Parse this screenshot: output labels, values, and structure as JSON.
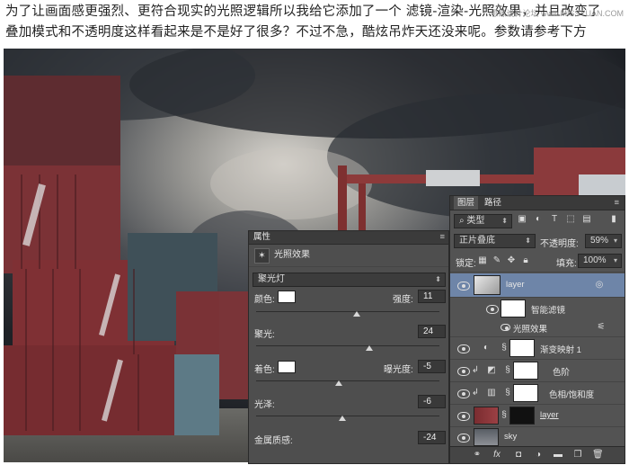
{
  "intro": {
    "line1": "为了让画面感更强烈、更符合现实的光照逻辑所以我给它添加了一个 滤镜-渲染-光照效果，并且改变了",
    "line2": "叠加模式和不透明度这样看起来是不是好了很多？不过不急，酷炫吊炸天还没来呢。参数请参考下方",
    "watermark": "思缘设计论坛 www.MISSYUAN.COM"
  },
  "properties": {
    "header": "属性",
    "title": "光照效果",
    "preset": "聚光灯",
    "color_label": "颜色:",
    "intensity_label": "强度:",
    "intensity": "11",
    "hotspot_label": "聚光:",
    "hotspot": "24",
    "colorize_label": "着色:",
    "exposure_label": "曝光度:",
    "exposure": "-5",
    "gloss_label": "光泽:",
    "gloss": "-6",
    "metallic_label": "金属质感:",
    "metallic": "-24",
    "sliders": {
      "intensity": 0.55,
      "hotspot": 0.62,
      "exposure": 0.45,
      "gloss": 0.47
    }
  },
  "layers": {
    "tabs": [
      "图层",
      "路径"
    ],
    "filter_kind": "类型",
    "blend_mode": "正片叠底",
    "opacity_label": "不透明度:",
    "opacity": "59%",
    "lock_label": "锁定:",
    "fill_label": "填充:",
    "fill": "100%",
    "items": [
      {
        "name": "layer",
        "type": "smart"
      },
      {
        "name": "智能滤镜",
        "type": "smart-filter"
      },
      {
        "name": "光照效果",
        "type": "filter"
      },
      {
        "name": "渐变映射 1",
        "type": "adjustment"
      },
      {
        "name": "色阶",
        "type": "adjustment"
      },
      {
        "name": "色相/饱和度",
        "type": "adjustment"
      },
      {
        "name": "layer",
        "type": "pixel"
      },
      {
        "name": "sky",
        "type": "pixel"
      }
    ],
    "footer_icons": [
      "link-icon",
      "fx-icon",
      "mask-icon",
      "adjustment-icon",
      "folder-icon",
      "new-layer-icon",
      "trash-icon"
    ]
  }
}
